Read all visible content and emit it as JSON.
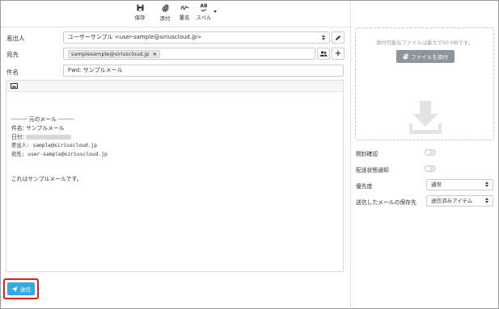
{
  "toolbar": {
    "save": "保存",
    "attach": "添付",
    "signature": "署名",
    "spell": "スペル",
    "spell_icon_text": "AB"
  },
  "form": {
    "from_label": "差出人",
    "from_value": "ユーザーサンプル <user-sample@siriuscloud.jp>",
    "to_label": "宛先",
    "to_chip": "samplesample@siriuscloud.jp",
    "to_chip_remove": "×",
    "subject_label": "件名",
    "subject_value": "Fwd: サンプルメール",
    "add_symbol": "+"
  },
  "body": {
    "separator": "-------- 元のメール --------",
    "subject_line": "件名: サンプルメール",
    "date_label": "日付:",
    "from_line": "差出人: sample@siriuscloud.jp",
    "to_line": "宛先: user-sample@siriuscloud.jp",
    "message": "これはサンプルメールです。"
  },
  "send": {
    "label": "送信"
  },
  "attachments": {
    "limit_note": "添付可能なファイルは最大で50 MBです。",
    "attach_button": "ファイルを添付"
  },
  "options": {
    "read_receipt": "開封確認",
    "delivery_notice": "配送状態通知",
    "priority_label": "優先度",
    "priority_value": "通常",
    "save_sent_label": "送信したメールの保存先",
    "save_sent_value": "送信済みアイテム"
  },
  "colors": {
    "send_button": "#3aa8e0",
    "highlight_border": "#e0201e",
    "attach_button": "#8d959c"
  },
  "icons": [
    "save-icon",
    "paperclip-icon",
    "signature-icon",
    "spellcheck-icon",
    "pencil-icon",
    "contacts-icon",
    "image-icon",
    "paper-plane-icon",
    "download-icon"
  ]
}
